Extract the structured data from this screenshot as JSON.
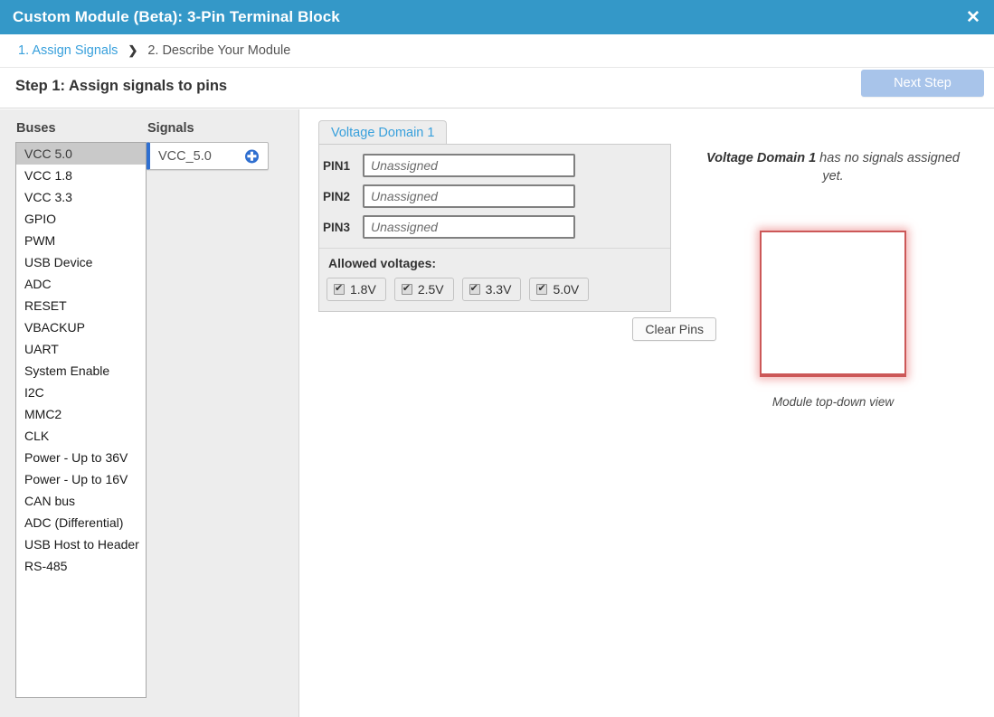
{
  "window": {
    "title": "Custom Module (Beta): 3-Pin Terminal Block",
    "close_label": "✕",
    "header_color": "#3498c8"
  },
  "breadcrumb": {
    "step1_label": "1. Assign Signals",
    "separator": "❯",
    "step2_label": "2. Describe Your Module",
    "active_color": "#38a0dc"
  },
  "stepbar": {
    "title": "Step 1: Assign signals to pins",
    "next_button_label": "Next Step",
    "next_button_color": "#a8c4ea"
  },
  "sidebar": {
    "buses_heading": "Buses",
    "signals_heading": "Signals",
    "buses": [
      {
        "label": "VCC 5.0",
        "selected": true
      },
      {
        "label": "VCC 1.8",
        "selected": false
      },
      {
        "label": "VCC 3.3",
        "selected": false
      },
      {
        "label": "GPIO",
        "selected": false
      },
      {
        "label": "PWM",
        "selected": false
      },
      {
        "label": "USB Device",
        "selected": false
      },
      {
        "label": "ADC",
        "selected": false
      },
      {
        "label": "RESET",
        "selected": false
      },
      {
        "label": "VBACKUP",
        "selected": false
      },
      {
        "label": "UART",
        "selected": false
      },
      {
        "label": "System Enable",
        "selected": false
      },
      {
        "label": "I2C",
        "selected": false
      },
      {
        "label": "MMC2",
        "selected": false
      },
      {
        "label": "CLK",
        "selected": false
      },
      {
        "label": "Power - Up to 36V",
        "selected": false
      },
      {
        "label": "Power - Up to 16V",
        "selected": false
      },
      {
        "label": "CAN bus",
        "selected": false
      },
      {
        "label": "ADC (Differential)",
        "selected": false
      },
      {
        "label": "USB Host to Header",
        "selected": false
      },
      {
        "label": "RS-485",
        "selected": false
      }
    ],
    "signal_chip": {
      "label": "VCC_5.0",
      "add_icon": "✚",
      "accent_color": "#2f6fd0"
    }
  },
  "voltage_domain": {
    "tab_label": "Voltage Domain 1",
    "pins": [
      {
        "label": "PIN1",
        "value": "",
        "placeholder": "Unassigned"
      },
      {
        "label": "PIN2",
        "value": "",
        "placeholder": "Unassigned"
      },
      {
        "label": "PIN3",
        "value": "",
        "placeholder": "Unassigned"
      }
    ],
    "allowed_voltages_title": "Allowed voltages:",
    "voltages": [
      {
        "label": "1.8V",
        "checked": true
      },
      {
        "label": "2.5V",
        "checked": true
      },
      {
        "label": "3.3V",
        "checked": true
      },
      {
        "label": "5.0V",
        "checked": true
      }
    ],
    "clear_pins_label": "Clear Pins"
  },
  "preview": {
    "note_bold": "Voltage Domain 1",
    "note_rest": " has no signals assigned yet.",
    "caption": "Module top-down view",
    "module_border_color": "#cc5858"
  }
}
